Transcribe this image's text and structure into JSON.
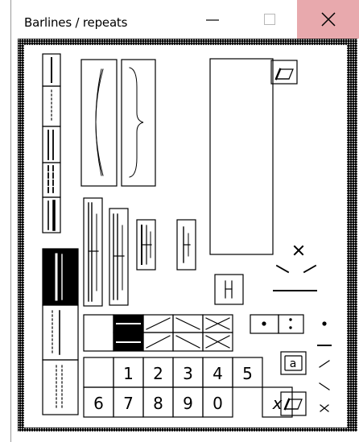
{
  "window": {
    "title": "Barlines / repeats",
    "controls": {
      "minimize": "minimize-icon",
      "maximize": "maximize-icon",
      "close": "close-icon"
    },
    "colors": {
      "close_hover": "#e8a9ad",
      "frame_pattern": "#000000",
      "canvas": "#ffffff"
    }
  },
  "palette": {
    "digits_row1": [
      "1",
      "2",
      "3",
      "4",
      "5"
    ],
    "digits_row2": [
      "6",
      "7",
      "8",
      "9",
      "0"
    ],
    "multiply_symbol": "x",
    "letter_a": "a",
    "icons": [
      "single-barline-icon",
      "dotted-barline-icon",
      "double-barline-icon",
      "dashed-double-barline-icon",
      "final-barline-icon",
      "parenthesis-bracket-icon",
      "curly-brace-icon",
      "start-repeat-icon",
      "double-start-repeat-icon",
      "heavy-start-repeat-icon",
      "thin-repeat-icon",
      "short-barline-icon",
      "inverted-barline-icon",
      "long-dotted-barline-icon",
      "short-dotted-barline-icon",
      "eraser-icon",
      "caret-mark-icon",
      "slash-mark-icon",
      "dot-mark-icon",
      "colon-mark-icon",
      "tie-mark-icon"
    ]
  }
}
